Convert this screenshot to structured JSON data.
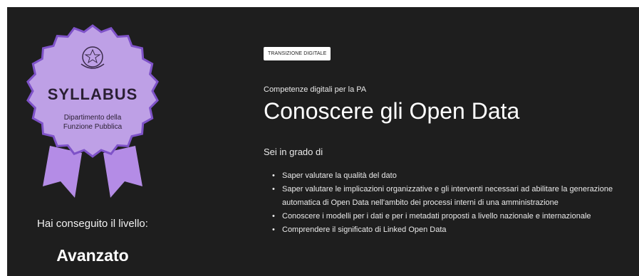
{
  "badge": {
    "brand": "SYLLABUS",
    "caption_line1": "Dipartimento della",
    "caption_line2": "Funzione Pubblica",
    "emblem_icon": "italian-republic-emblem-icon",
    "colors": {
      "fill": "#bea0e6",
      "border": "#8c5fd2",
      "ribbon": "#b48ce6"
    }
  },
  "achievement": {
    "label": "Hai conseguito il livello:",
    "level": "Avanzato"
  },
  "course": {
    "tag": "TRANSIZIONE DIGITALE",
    "subtitle": "Competenze digitali per la PA",
    "title": "Conoscere gli Open Data",
    "lead": "Sei in grado di",
    "skills": [
      "Saper valutare la qualità del dato",
      "Saper valutare le implicazioni organizzative e gli interventi necessari ad abilitare la generazione automatica di Open Data nell'ambito dei processi interni di una amministrazione",
      "Conoscere i modelli per i dati e per i metadati proposti a livello nazionale e internazionale",
      "Comprendere il significato di Linked Open Data"
    ]
  },
  "colors": {
    "background": "#1e1e1e",
    "text": "#ffffff",
    "tag_bg": "#ffffff"
  }
}
